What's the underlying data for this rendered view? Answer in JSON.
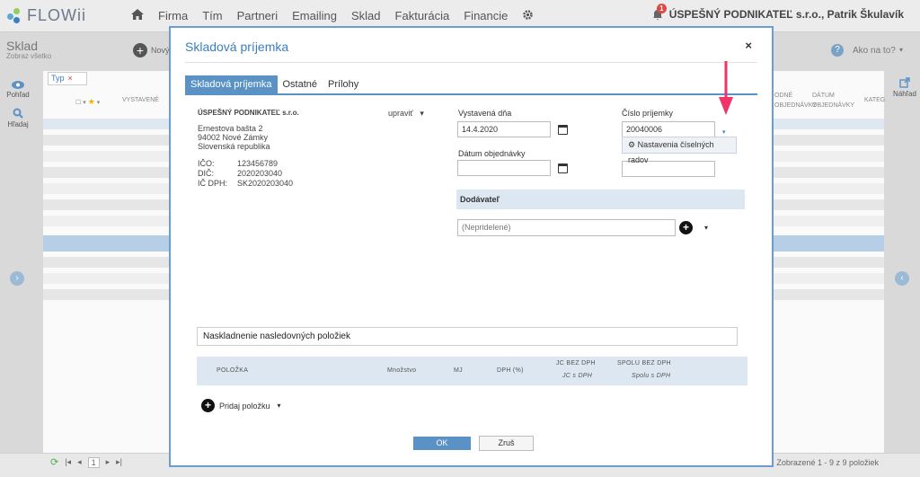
{
  "app": {
    "logo": "FLOWii"
  },
  "nav": {
    "items": [
      "Firma",
      "Tím",
      "Partneri",
      "Emailing",
      "Sklad",
      "Fakturácia",
      "Financie"
    ]
  },
  "user": {
    "name": "ÚSPEŠNÝ PODNIKATEĽ s.r.o., Patrik Škulavík",
    "badge": "1"
  },
  "page": {
    "title": "Sklad",
    "subtitle": "Zobraz všetko",
    "new_label": "Nový",
    "help": "Ako na to?",
    "left": {
      "view": "Pohľad",
      "search": "Hľadaj"
    },
    "right": {
      "preview": "Náhľad"
    },
    "filter": "Typ",
    "columns": {
      "issued": "VYSTAVENÉ",
      "r1": "ODNÉ",
      "r1b": "OBJEDNÁVKY",
      "r2": "DÁTUM",
      "r2b": "OBJEDNÁVKY",
      "r3": "KATEG"
    },
    "pager_page": "1",
    "shown": "Zobrazené 1 - 9 z 9 položiek"
  },
  "modal": {
    "title": "Skladová príjemka",
    "close": "×",
    "tabs": [
      "Skladová príjemka",
      "Ostatné",
      "Prílohy"
    ],
    "company": {
      "name": "ÚSPEŠNÝ PODNIKATEĽ s.r.o.",
      "edit": "upraviť",
      "address": [
        "Ernestova bašta 2",
        "94002 Nové Zámky",
        "Slovenská republika"
      ],
      "ico_label": "IČO:",
      "ico": "123456789",
      "dic_label": "DIČ:",
      "dic": "2020203040",
      "icdph_label": "IČ DPH:",
      "icdph": "SK2020203040"
    },
    "issued_label": "Vystavená dňa",
    "issued_value": "14.4.2020",
    "number_label": "Číslo príjemky",
    "number_value": "20040006",
    "number_settings": "Nastavenia číselných radov",
    "order_date_label": "Dátum objednávky",
    "order_date_value": "",
    "supplier_header": "Dodávateľ",
    "supplier_placeholder": "(Nepridelené)",
    "stock_in_text": "Naskladnenie nasledovných položiek",
    "items_cols": {
      "item": "POLOŽKA",
      "qty": "Množstvo",
      "unit": "MJ",
      "vat": "DPH (%)",
      "unit_price": "JC BEZ DPH",
      "unit_price_vat": "JC s DPH",
      "total": "SPOLU BEZ DPH",
      "total_vat": "Spolu s DPH"
    },
    "add_item": "Pridaj položku",
    "ok": "OK",
    "cancel": "Zruš"
  },
  "colors": {
    "accent": "#5b92c5",
    "arrow": "#f0336b",
    "header_bg": "#dde7f1"
  },
  "icons": [
    "home-icon",
    "gear-icon",
    "bell-icon",
    "calendar-icon",
    "plus-icon",
    "caret-down-icon",
    "close-icon",
    "eye-icon",
    "search-icon",
    "external-link-icon",
    "refresh-icon",
    "help-icon"
  ]
}
